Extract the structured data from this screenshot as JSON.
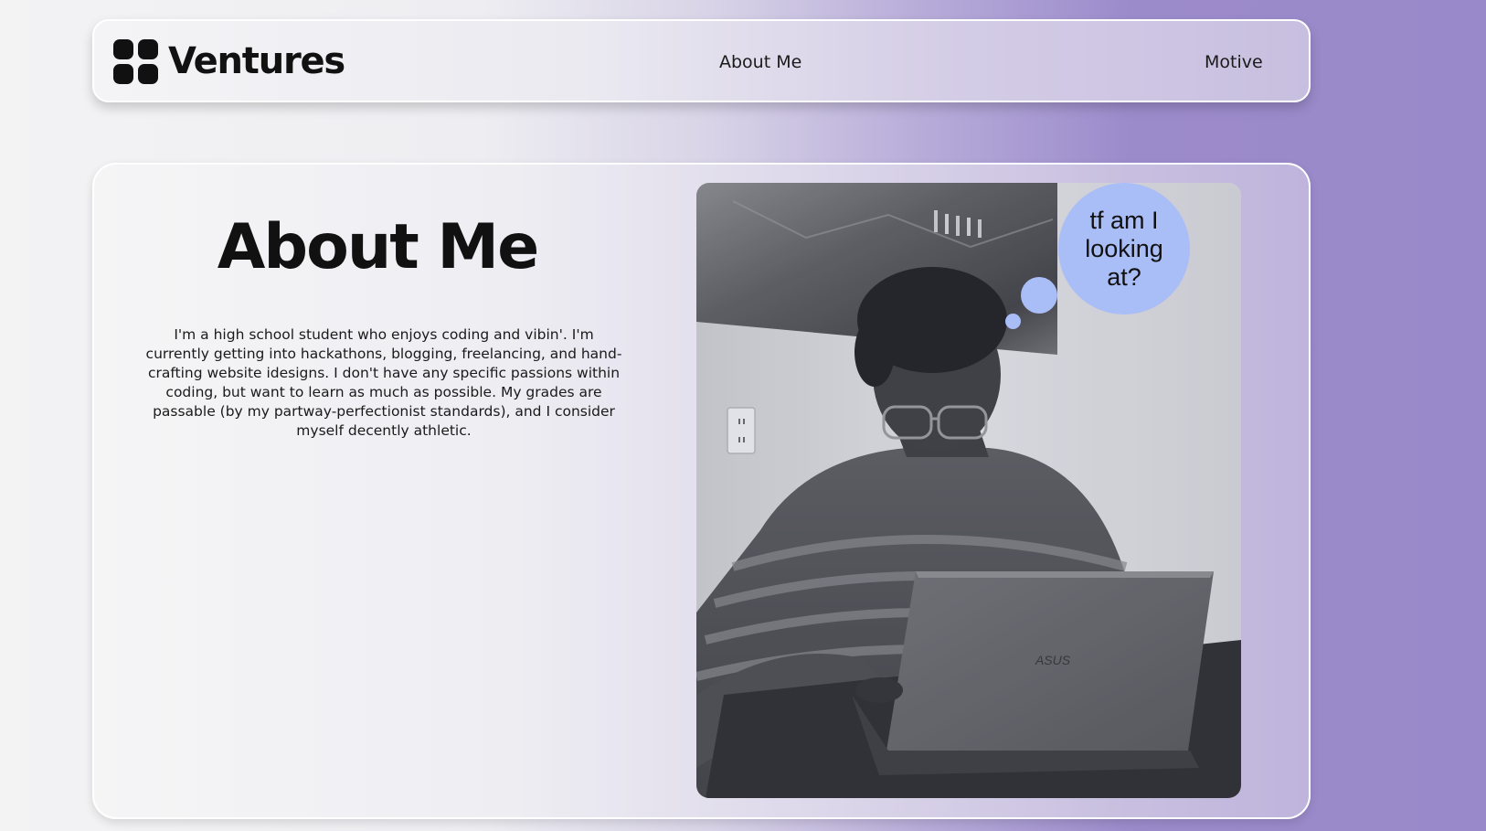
{
  "brand": {
    "name": "Ventures"
  },
  "nav": {
    "items": [
      {
        "label": "About Me"
      },
      {
        "label": "Motive"
      }
    ]
  },
  "about": {
    "title": "About Me",
    "body": "I'm a high school student who enjoys coding and vibin'. I'm currently getting into hackathons, blogging, freelancing, and hand-crafting website idesigns. I don't have any specific passions within coding, but want to learn as much as possible. My grades are passable (by my partway-perfectionist standards), and I consider myself decently athletic.",
    "photo": {
      "laptop_brand": "ASUS",
      "thought_bubble": "tf am I looking at?"
    }
  },
  "colors": {
    "accent_purple": "#9a89ca",
    "bubble_blue": "#a9bdf6",
    "text_dark": "#111111"
  }
}
